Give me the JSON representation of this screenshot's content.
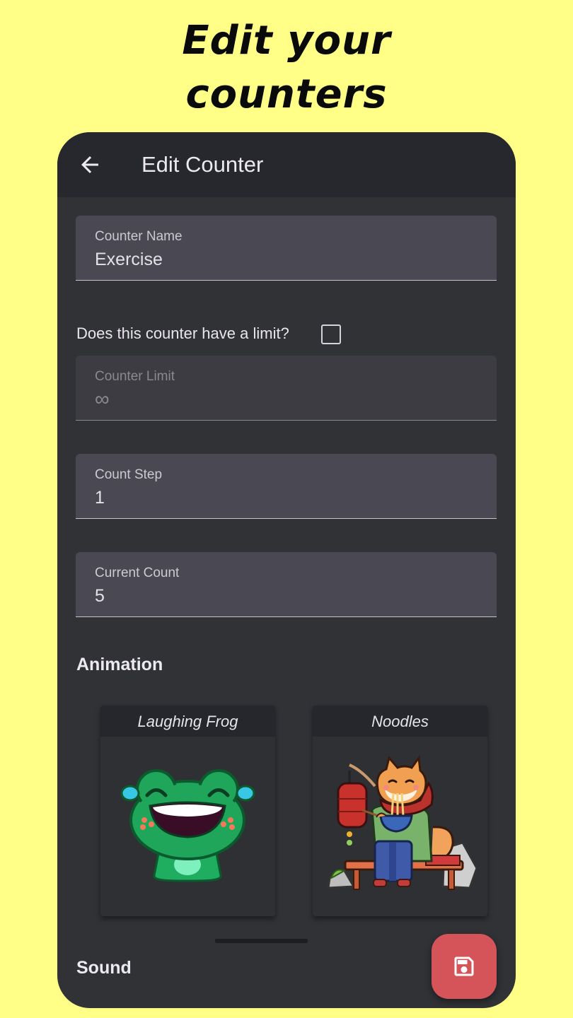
{
  "promo": {
    "line1": "Edit your",
    "line2": "counters"
  },
  "appbar": {
    "title": "Edit Counter",
    "back_icon": "arrow-left-icon"
  },
  "fields": {
    "name": {
      "label": "Counter Name",
      "value": "Exercise"
    },
    "limit_question": "Does this counter have a limit?",
    "limit_checked": false,
    "limit": {
      "label": "Counter Limit",
      "value": "∞"
    },
    "step": {
      "label": "Count Step",
      "value": "1"
    },
    "current": {
      "label": "Current Count",
      "value": "5"
    }
  },
  "sections": {
    "animation": "Animation",
    "sound": "Sound"
  },
  "animations": [
    {
      "name": "Laughing Frog"
    },
    {
      "name": "Noodles"
    }
  ],
  "fab": {
    "icon": "save-icon"
  },
  "colors": {
    "page_bg": "#FFFF88",
    "surface": "#313236",
    "appbar": "#26282d",
    "field_bg": "#4a4852",
    "fab": "#d4545a"
  }
}
